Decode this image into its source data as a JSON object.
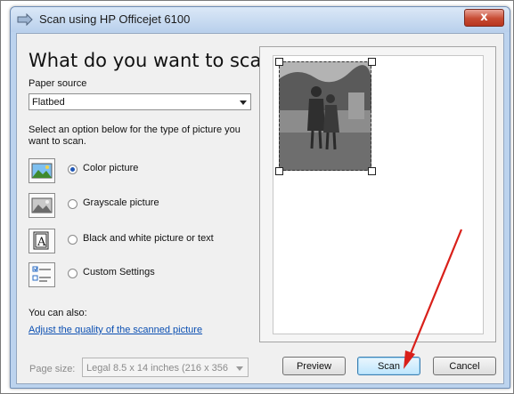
{
  "window": {
    "title": "Scan using HP Officejet 6100",
    "close_label": "x"
  },
  "heading": "What do you want to scan?",
  "paper_source": {
    "label": "Paper source",
    "value": "Flatbed"
  },
  "instruction": "Select an option below for the type of picture you want to scan.",
  "options": [
    {
      "label": "Color picture",
      "selected": true,
      "icon": "color-picture-icon"
    },
    {
      "label": "Grayscale picture",
      "selected": false,
      "icon": "grayscale-picture-icon"
    },
    {
      "label": "Black and white picture or text",
      "selected": false,
      "icon": "bw-text-icon"
    },
    {
      "label": "Custom Settings",
      "selected": false,
      "icon": "custom-settings-icon"
    }
  ],
  "also": {
    "label": "You can also:",
    "link": "Adjust the quality of the scanned picture"
  },
  "page_size": {
    "label": "Page size:",
    "value": "Legal 8.5 x 14 inches (216 x 356"
  },
  "buttons": {
    "preview": "Preview",
    "scan": "Scan",
    "cancel": "Cancel"
  },
  "colors": {
    "accent_arrow": "#d9201a",
    "link": "#0b4fb2",
    "selected_radio": "#1f56b5"
  }
}
